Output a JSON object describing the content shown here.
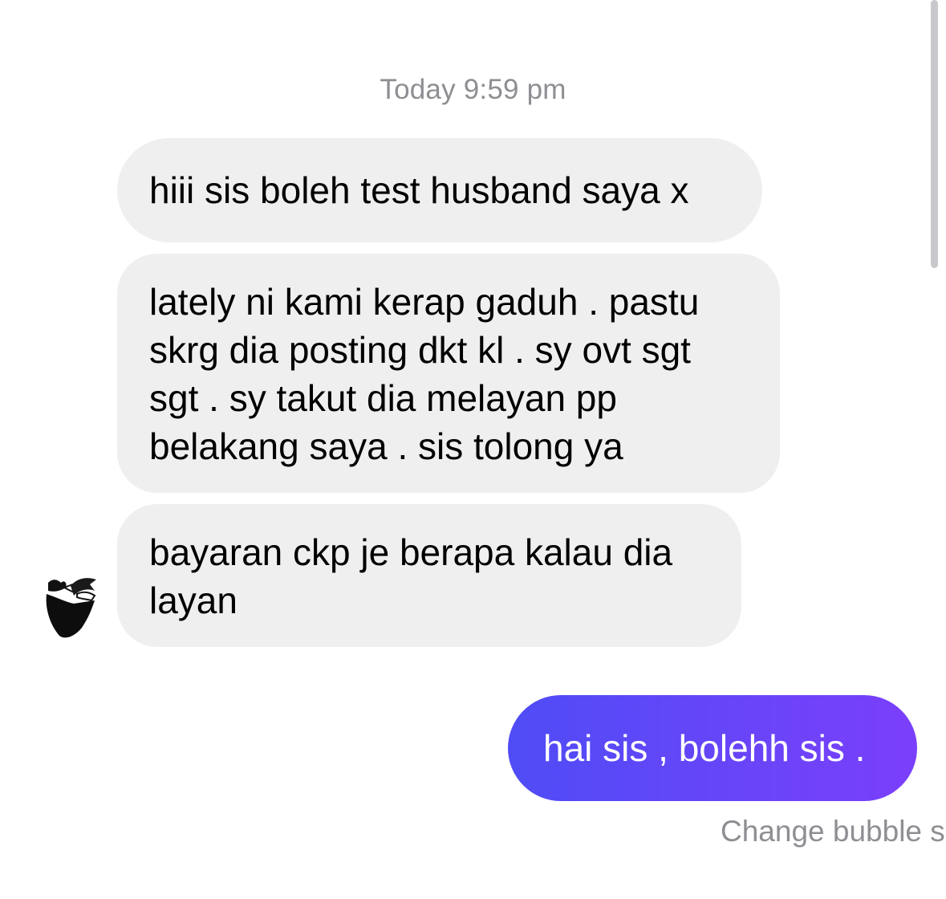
{
  "thread": {
    "timestamp": "Today 9:59 pm",
    "incoming": [
      {
        "lines": [
          "hiii sis boleh test husband saya x"
        ]
      },
      {
        "lines": [
          "lately ni kami kerap gaduh . pastu",
          "skrg dia posting dkt kl . sy ovt sgt",
          "sgt . sy takut dia melayan pp",
          "belakang saya . sis tolong ya"
        ]
      },
      {
        "lines": [
          "bayaran ckp je berapa kalau dia",
          "layan"
        ]
      }
    ],
    "outgoing": [
      {
        "text": "hai sis , bolehh sis ."
      }
    ],
    "footer_link": "Change bubble s"
  },
  "colors": {
    "incoming_bubble": "#efefef",
    "outgoing_gradient_start": "#4f4cf6",
    "outgoing_gradient_end": "#7b3ffb",
    "meta_text": "#8e8e93"
  },
  "icons": {
    "avatar": "profile-avatar-icon"
  }
}
